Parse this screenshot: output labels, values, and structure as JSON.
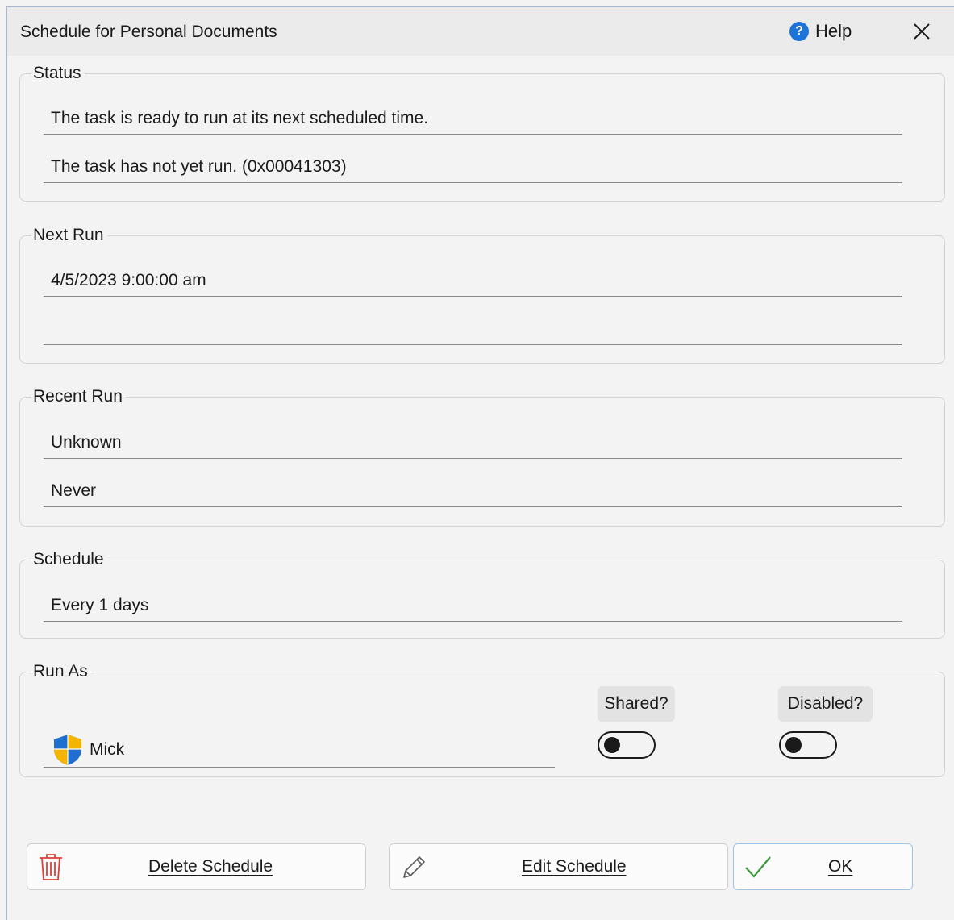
{
  "window": {
    "title": "Schedule for Personal Documents",
    "help_label": "Help"
  },
  "status": {
    "legend": "Status",
    "line1": "The task is ready to run at its next scheduled time.",
    "line2": "The task has not yet run. (0x00041303)"
  },
  "next_run": {
    "legend": "Next Run",
    "line1": "4/5/2023 9:00:00 am",
    "line2": ""
  },
  "recent_run": {
    "legend": "Recent Run",
    "line1": "Unknown",
    "line2": "Never"
  },
  "schedule": {
    "legend": "Schedule",
    "line1": "Every 1 days"
  },
  "run_as": {
    "legend": "Run As",
    "user": "Mick",
    "user_icon": "uac-shield-icon",
    "shared_label": "Shared?",
    "shared_on": false,
    "disabled_label": "Disabled?",
    "disabled_on": false
  },
  "buttons": {
    "delete": "Delete Schedule",
    "edit": "Edit Schedule",
    "ok": "OK"
  },
  "colors": {
    "help_icon": "#1e73d8",
    "delete_icon": "#e0403a",
    "ok_check": "#3a9a3a"
  }
}
